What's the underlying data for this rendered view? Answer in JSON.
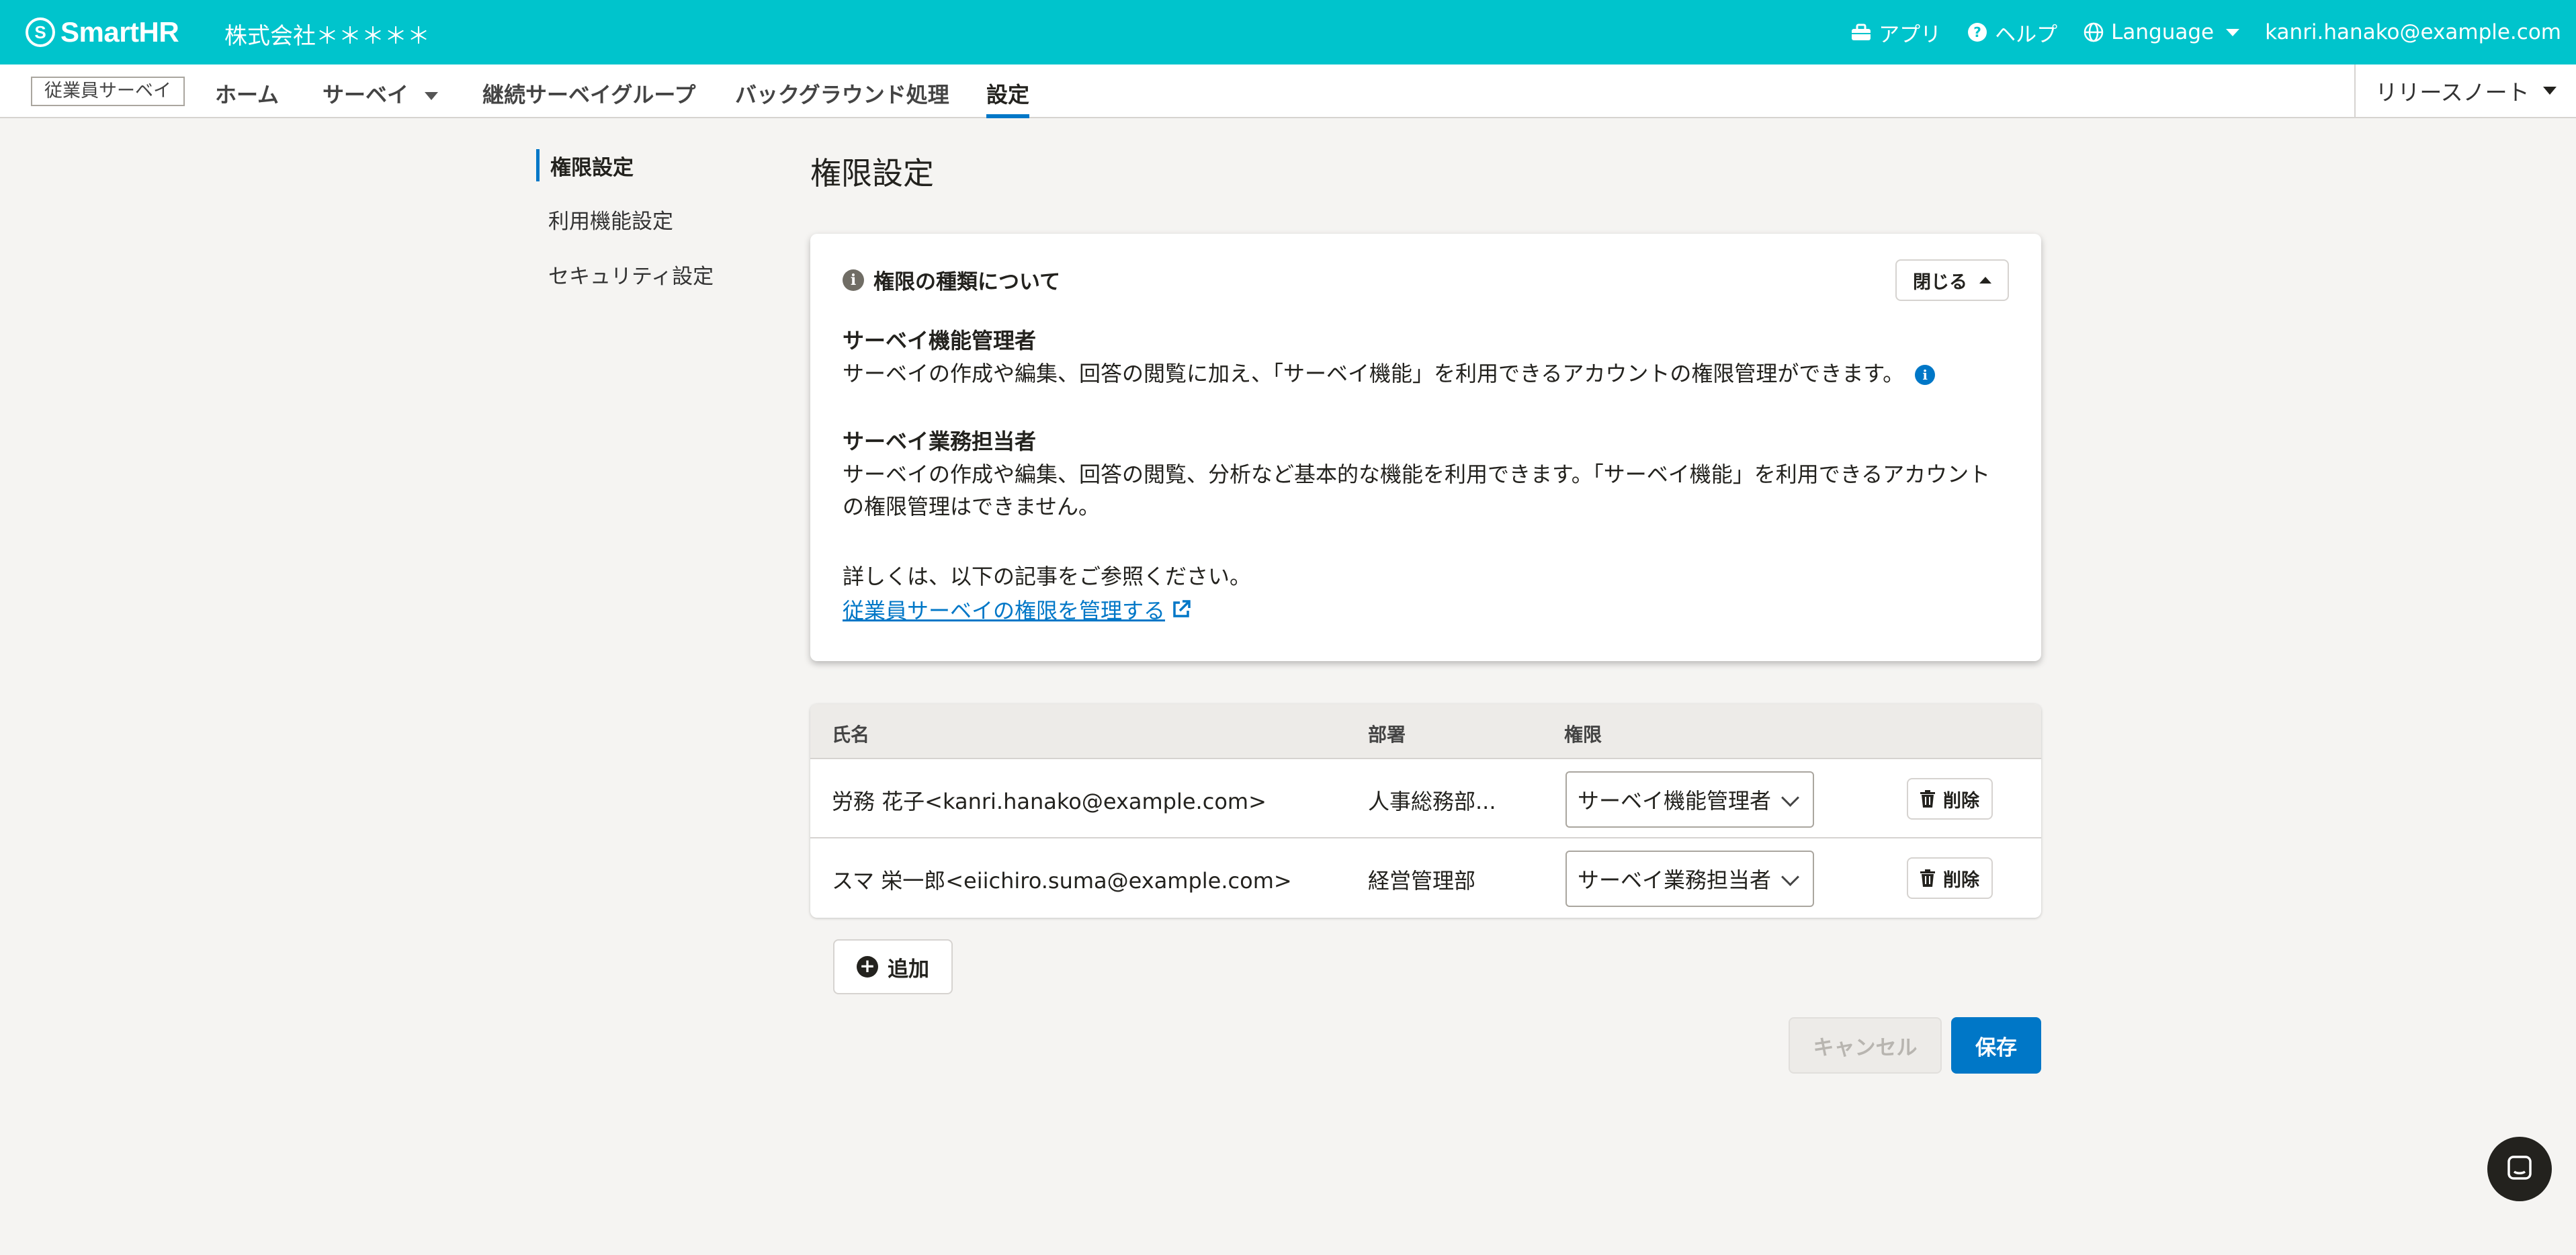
{
  "header": {
    "brand": "SmartHR",
    "company": "株式会社＊＊＊＊＊",
    "apps_label": "アプリ",
    "help_label": "ヘルプ",
    "language_label": "Language",
    "user_email": "kanri.hanako@example.com",
    "bg_color": "#00c4cc"
  },
  "subnav": {
    "product": "従業員サーベイ",
    "tabs": [
      {
        "label": "ホーム"
      },
      {
        "label": "サーベイ"
      },
      {
        "label": "継続サーベイグループ"
      },
      {
        "label": "バックグラウンド処理"
      },
      {
        "label": "設定",
        "active": true
      }
    ],
    "release_notes": "リリースノート"
  },
  "sidebar": {
    "items": [
      {
        "label": "権限設定",
        "active": true
      },
      {
        "label": "利用機能設定"
      },
      {
        "label": "セキュリティ設定"
      }
    ]
  },
  "main": {
    "title": "権限設定",
    "info_panel": {
      "heading": "権限の種類について",
      "close_label": "閉じる",
      "roles": [
        {
          "title": "サーベイ機能管理者",
          "description": "サーベイの作成や編集、回答の閲覧に加え、「サーベイ機能」を利用できるアカウントの権限管理ができます。"
        },
        {
          "title": "サーベイ業務担当者",
          "description": "サーベイの作成や編集、回答の閲覧、分析など基本的な機能を利用できます。「サーベイ機能」を利用できるアカウントの権限管理はできません。"
        }
      ],
      "details_text": "詳しくは、以下の記事をご参照ください。",
      "link_text": "従業員サーベイの権限を管理する"
    },
    "table": {
      "columns": [
        "氏名",
        "部署",
        "権限"
      ],
      "rows": [
        {
          "name": "労務 花子<kanri.hanako@example.com>",
          "department": "人事総務部...",
          "role": "サーベイ機能管理者",
          "delete_label": "削除"
        },
        {
          "name": "スマ 栄一郎<eiichiro.suma@example.com>",
          "department": "経営管理部",
          "role": "サーベイ業務担当者",
          "delete_label": "削除"
        }
      ]
    },
    "add_label": "追加",
    "cancel_label": "キャンセル",
    "save_label": "保存"
  },
  "colors": {
    "accent": "#0077c7",
    "header": "#00c4cc"
  }
}
